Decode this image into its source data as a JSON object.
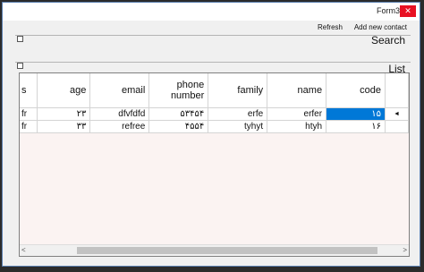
{
  "window": {
    "title": "Form3",
    "close_icon": "close-icon"
  },
  "menu": {
    "refresh": "Refresh",
    "add_new_contact": "Add new contact"
  },
  "sections": {
    "search": "Search",
    "list": "List"
  },
  "grid": {
    "columns": [
      "s",
      "age",
      "email",
      "phone number",
      "family",
      "name",
      "code"
    ],
    "rows": [
      {
        "s": "fr",
        "age": "۲۳",
        "email": "dfvfdfd",
        "phone": "۵۳۴۵۴",
        "family": "erfe",
        "name": "erfer",
        "code": "۱۵",
        "selected": true
      },
      {
        "s": "fr",
        "age": "۳۳",
        "email": "refree",
        "phone": "۴۵۵۴",
        "family": "tyhyt",
        "name": "htyh",
        "code": "۱۶",
        "selected": false
      }
    ],
    "current_row_indicator": "◄"
  },
  "scrollbar": {
    "left": "<",
    "right": ">"
  }
}
